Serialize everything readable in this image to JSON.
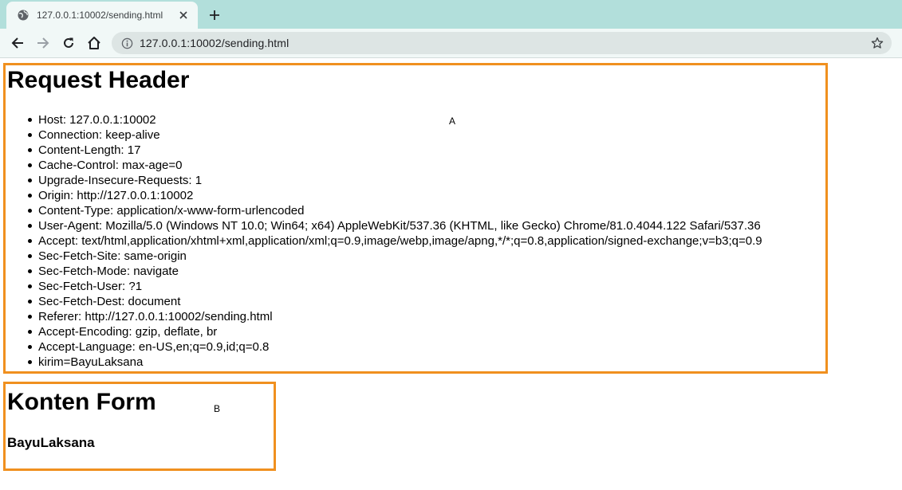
{
  "browser": {
    "tab": {
      "title": "127.0.0.1:10002/sending.html"
    },
    "url": "127.0.0.1:10002/sending.html",
    "icons": {
      "favicon": "globe-icon",
      "close": "close-icon",
      "new_tab": "plus-icon",
      "back": "back-arrow-icon",
      "forward": "forward-arrow-icon",
      "reload": "reload-icon",
      "home": "home-icon",
      "site_info": "info-icon",
      "bookmark": "star-icon"
    }
  },
  "colors": {
    "tab_strip": "#b2dfdb",
    "toolbar": "#f1f8f7",
    "box_border": "#f0901f"
  },
  "section_a": {
    "heading": "Request Header",
    "label": "A",
    "headers": [
      "Host: 127.0.0.1:10002",
      "Connection: keep-alive",
      "Content-Length: 17",
      "Cache-Control: max-age=0",
      "Upgrade-Insecure-Requests: 1",
      "Origin: http://127.0.0.1:10002",
      "Content-Type: application/x-www-form-urlencoded",
      "User-Agent: Mozilla/5.0 (Windows NT 10.0; Win64; x64) AppleWebKit/537.36 (KHTML, like Gecko) Chrome/81.0.4044.122 Safari/537.36",
      "Accept: text/html,application/xhtml+xml,application/xml;q=0.9,image/webp,image/apng,*/*;q=0.8,application/signed-exchange;v=b3;q=0.9",
      "Sec-Fetch-Site: same-origin",
      "Sec-Fetch-Mode: navigate",
      "Sec-Fetch-User: ?1",
      "Sec-Fetch-Dest: document",
      "Referer: http://127.0.0.1:10002/sending.html",
      "Accept-Encoding: gzip, deflate, br",
      "Accept-Language: en-US,en;q=0.9,id;q=0.8",
      "kirim=BayuLaksana"
    ]
  },
  "section_b": {
    "heading": "Konten Form",
    "label": "B",
    "value": "BayuLaksana"
  }
}
